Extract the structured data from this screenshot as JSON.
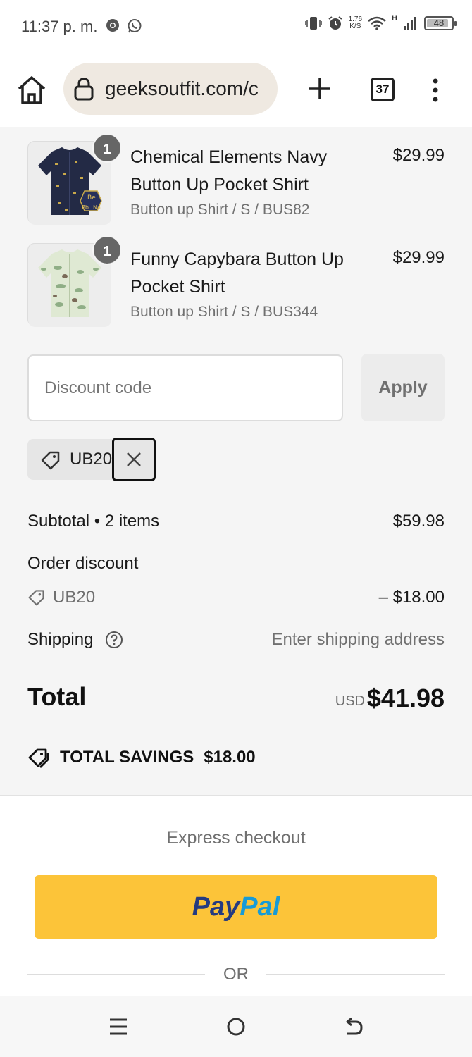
{
  "status_bar": {
    "time": "11:37 p. m.",
    "net_speed_value": "1.76",
    "net_speed_unit": "K/S",
    "network_type": "H",
    "battery": "48",
    "icons": [
      "chrome-icon",
      "whatsapp-icon",
      "vibrate-icon",
      "alarm-icon",
      "wifi-icon",
      "signal-icon",
      "battery-icon"
    ]
  },
  "browser": {
    "url": "geeksoutfit.com/c",
    "tab_count": "37",
    "icons": [
      "home-icon",
      "lock-icon",
      "plus-icon",
      "kebab-menu-icon"
    ]
  },
  "cart": {
    "items": [
      {
        "name": "Chemical Elements Navy Button Up Pocket Shirt",
        "variant": "Button up Shirt / S / BUS82",
        "price": "$29.99",
        "quantity": "1"
      },
      {
        "name": "Funny Capybara Button Up Pocket Shirt",
        "variant": "Button up Shirt / S / BUS344",
        "price": "$29.99",
        "quantity": "1"
      }
    ]
  },
  "discount": {
    "placeholder": "Discount code",
    "apply_label": "Apply",
    "applied_code": "UB20"
  },
  "totals": {
    "subtotal_label": "Subtotal • 2 items",
    "subtotal_value": "$59.98",
    "order_discount_label": "Order discount",
    "discount_code": "UB20",
    "discount_value": "– $18.00",
    "shipping_label": "Shipping",
    "shipping_value": "Enter shipping address",
    "total_label": "Total",
    "currency": "USD",
    "total_value": "$41.98",
    "savings_label": "TOTAL SAVINGS",
    "savings_value": "$18.00"
  },
  "express": {
    "title": "Express checkout",
    "paypal_part1": "Pay",
    "paypal_part2": "Pal",
    "or_label": "OR"
  },
  "colors": {
    "paypal_yellow": "#fcc439",
    "paypal_dark_blue": "#253b80",
    "paypal_light_blue": "#179bd7",
    "summary_bg": "#f5f5f5",
    "urlbar_bg": "#efe9e1"
  }
}
